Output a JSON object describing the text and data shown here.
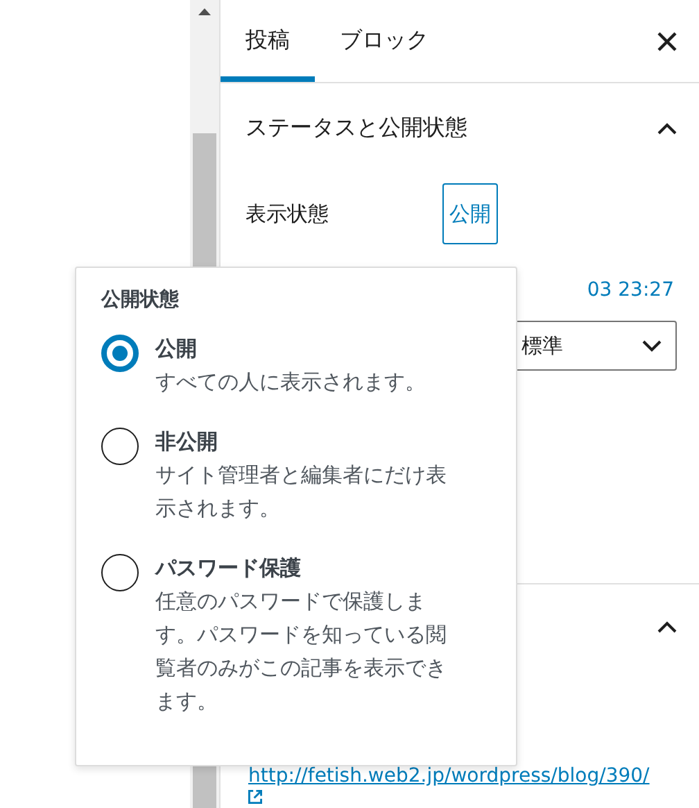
{
  "tabs": [
    {
      "label": "投稿",
      "selected": true
    },
    {
      "label": "ブロック",
      "selected": false
    }
  ],
  "status_panel": {
    "title": "ステータスと公開状態",
    "expanded": true,
    "visibility_label": "表示状態",
    "visibility_button": "公開",
    "date_fragment": "03 23:27",
    "template_select": "標準"
  },
  "second_panel": {
    "expanded": true,
    "link": "http://fetish.web2.jp/wordpress/blog/390/"
  },
  "popover": {
    "title": "公開状態",
    "options": [
      {
        "label": "公開",
        "description": "すべての人に表示されます。",
        "selected": true
      },
      {
        "label": "非公開",
        "description": "サイト管理者と編集者にだけ表示されます。",
        "selected": false
      },
      {
        "label": "パスワード保護",
        "description": "任意のパスワードで保護します。パスワードを知っている閲覧者のみがこの記事を表示できます。",
        "selected": false
      }
    ]
  }
}
